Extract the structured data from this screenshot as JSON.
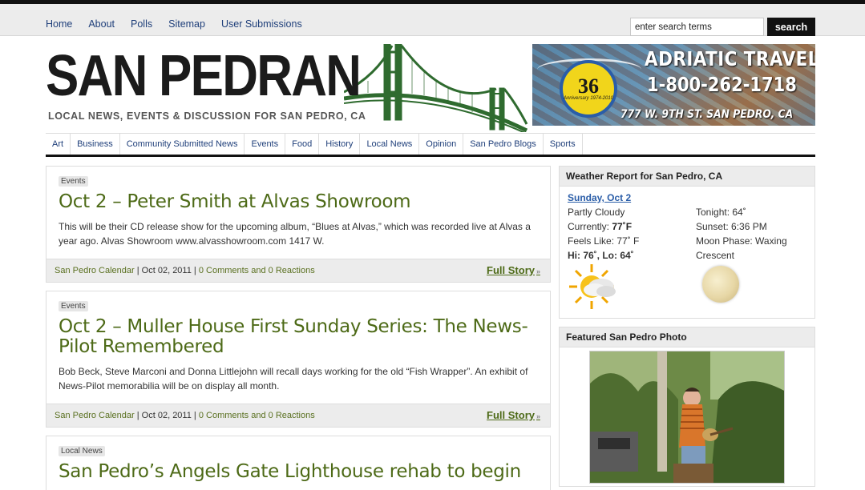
{
  "topnav": {
    "items": [
      "Home",
      "About",
      "Polls",
      "Sitemap",
      "User Submissions"
    ]
  },
  "search": {
    "value": "enter search terms",
    "button_label": "search"
  },
  "site": {
    "title": "SAN PEDRAN",
    "tagline": "LOCAL NEWS, EVENTS & DISCUSSION FOR SAN PEDRO, CA"
  },
  "ad": {
    "name": "ADRIATIC TRAVEL",
    "phone": "1-800-262-1718",
    "address": "777 W. 9TH ST.   SAN PEDRO, CA",
    "seal_number": "36",
    "seal_text": "Anniversary 1974-2010"
  },
  "catnav": {
    "items": [
      "Art",
      "Business",
      "Community Submitted News",
      "Events",
      "Food",
      "History",
      "Local News",
      "Opinion",
      "San Pedro Blogs",
      "Sports"
    ]
  },
  "posts": [
    {
      "category": "Events",
      "title": "Oct 2 – Peter Smith at Alvas Showroom",
      "excerpt": "This will be their CD release show for the upcoming album, “Blues at Alvas,” which was recorded live at Alvas a year ago. Alvas Showroom www.alvasshowroom.com 1417 W.",
      "source": "San Pedro Calendar",
      "date": "Oct 02, 2011",
      "comments": "0 Comments and 0 Reactions",
      "more": "Full Story"
    },
    {
      "category": "Events",
      "title": "Oct 2 – Muller House First Sunday Series: The News-Pilot Remembered",
      "excerpt": "Bob Beck, Steve Marconi and Donna Littlejohn will recall days working for the old “Fish Wrapper”. An exhibit of News-Pilot memorabilia will be on display all month.",
      "source": "San Pedro Calendar",
      "date": "Oct 02, 2011",
      "comments": "0 Comments and 0 Reactions",
      "more": "Full Story"
    },
    {
      "category": "Local News",
      "title": "San Pedro’s Angels Gate Lighthouse rehab to begin"
    }
  ],
  "weather": {
    "heading": "Weather Report for San Pedro, CA",
    "date": "Sunday, Oct 2",
    "condition": "Partly Cloudy",
    "currently_label": "Currently:",
    "currently": "77˚F",
    "feels_like": "Feels Like: 77˚ F",
    "hilo": "Hi: 76˚, Lo: 64˚",
    "tonight": "Tonight: 64˚",
    "sunset": "Sunset: 6:36 PM",
    "moon_phase": "Moon Phase: Waxing Crescent",
    "icon": "partly-cloudy-icon",
    "moon_icon": "moon-icon"
  },
  "featured": {
    "heading": "Featured San Pedro Photo"
  }
}
